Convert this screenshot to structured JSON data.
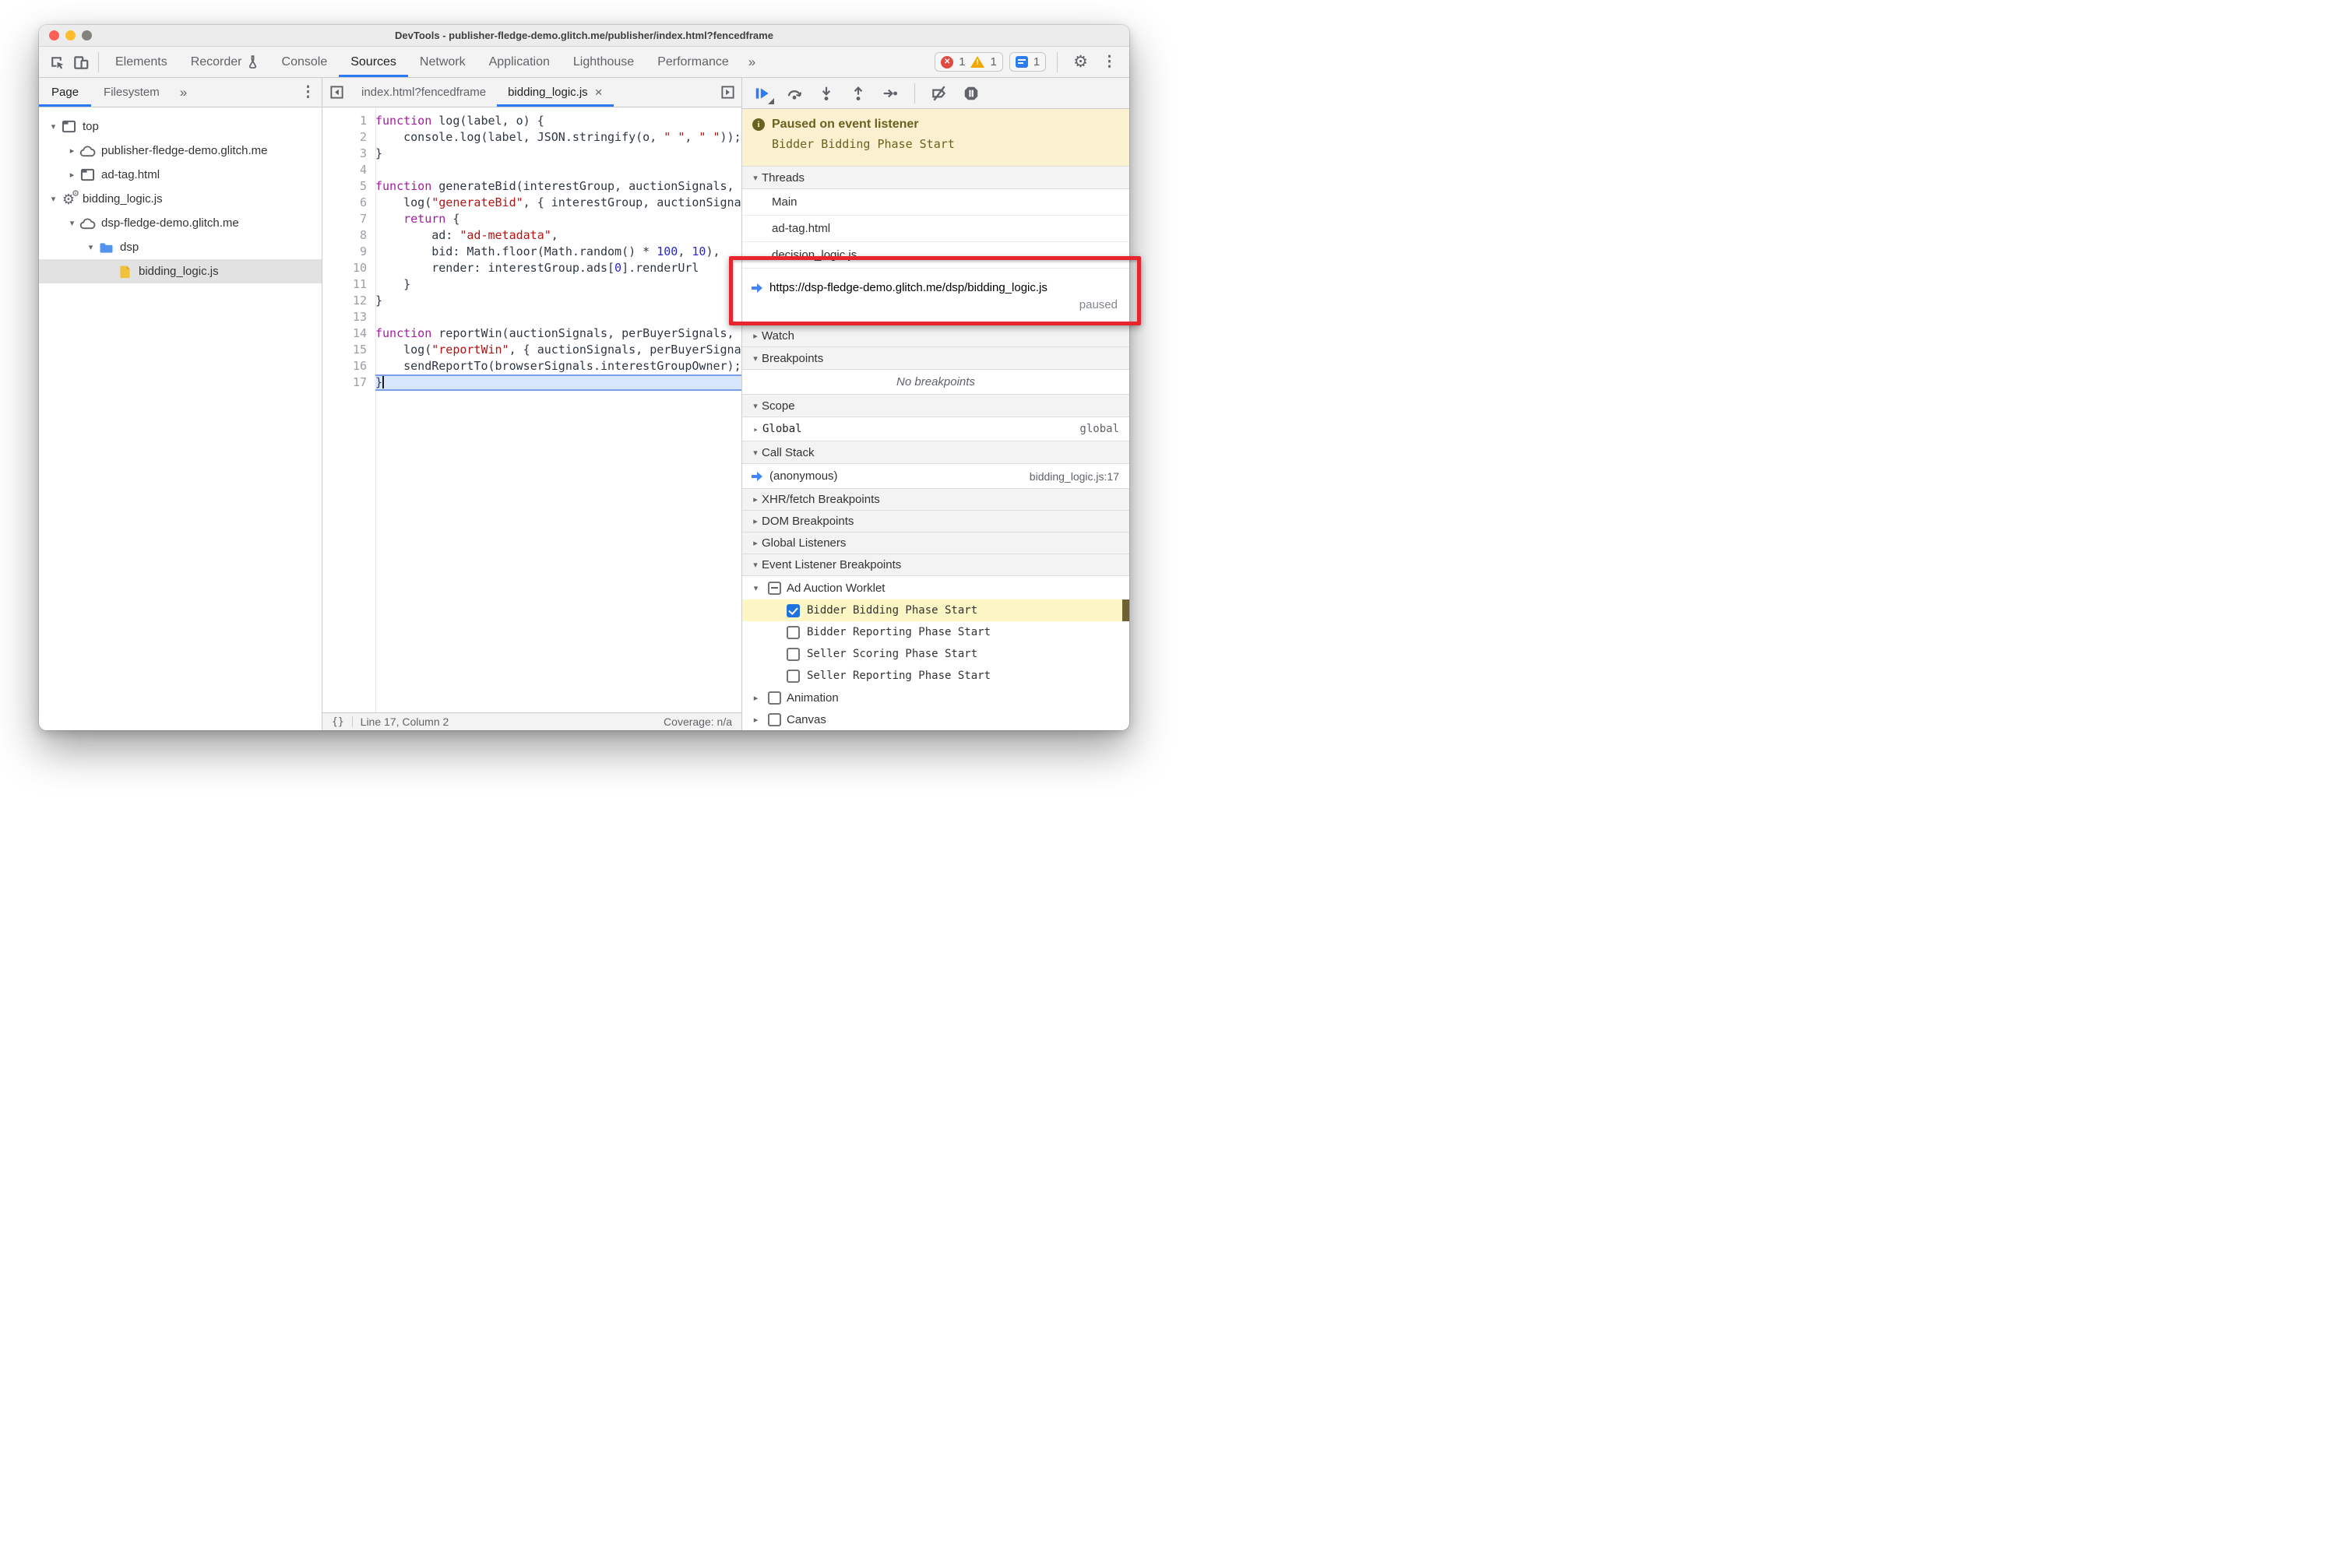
{
  "colors": {
    "accent_blue": "#2d7af7",
    "annotation_red": "#e8252c",
    "paused_banner_bg": "#fbf1d1",
    "paused_banner_text": "#6a6120",
    "highlight_row_yellow": "#fbf6c3",
    "exec_line_blue": "#d9e7fd",
    "traffic_close": "#fe5f57",
    "traffic_minimize": "#febc2e",
    "traffic_zoom_disabled": "#83837b"
  },
  "glyphs": {
    "expanded": "▾",
    "collapsed": "▸",
    "overflow": "»",
    "kebab": "⋮",
    "gear": "⚙",
    "close_tab": "×",
    "brackets": "{}"
  },
  "window": {
    "title": "DevTools - publisher-fledge-demo.glitch.me/publisher/index.html?fencedframe"
  },
  "toolbar": {
    "tabs": [
      {
        "label": "Elements"
      },
      {
        "label": "Recorder",
        "flask": true
      },
      {
        "label": "Console"
      },
      {
        "label": "Sources",
        "selected": true
      },
      {
        "label": "Network"
      },
      {
        "label": "Application"
      },
      {
        "label": "Lighthouse"
      },
      {
        "label": "Performance"
      }
    ],
    "error_count": "1",
    "warning_count": "1",
    "issue_count": "1"
  },
  "navigator": {
    "tabs": [
      {
        "label": "Page",
        "selected": true
      },
      {
        "label": "Filesystem"
      }
    ],
    "tree": [
      {
        "label": "top",
        "depth": 0,
        "icon": "frame",
        "expand": "open"
      },
      {
        "label": "publisher-fledge-demo.glitch.me",
        "depth": 1,
        "icon": "cloud",
        "expand": "closed"
      },
      {
        "label": "ad-tag.html",
        "depth": 1,
        "icon": "frame",
        "expand": "closed"
      },
      {
        "label": "bidding_logic.js",
        "depth": 0,
        "icon": "worker",
        "expand": "open"
      },
      {
        "label": "dsp-fledge-demo.glitch.me",
        "depth": 1,
        "icon": "cloud",
        "expand": "open"
      },
      {
        "label": "dsp",
        "depth": 2,
        "icon": "folder",
        "expand": "open"
      },
      {
        "label": "bidding_logic.js",
        "depth": 3,
        "icon": "file",
        "expand": "none",
        "selected": true
      }
    ]
  },
  "editor": {
    "tabs": [
      {
        "label": "index.html?fencedframe"
      },
      {
        "label": "bidding_logic.js",
        "selected": true,
        "close": "×"
      }
    ],
    "lines": [
      {
        "n": "1",
        "seg": [
          [
            "k",
            "function"
          ],
          [
            "d",
            " log(label, o) {"
          ]
        ]
      },
      {
        "n": "2",
        "seg": [
          [
            "d",
            "    console.log(label, JSON.stringify(o, "
          ],
          [
            "s",
            "\" \""
          ],
          [
            "d",
            ", "
          ],
          [
            "s",
            "\" \""
          ],
          [
            "d",
            "));"
          ]
        ]
      },
      {
        "n": "3",
        "seg": [
          [
            "d",
            "}"
          ]
        ]
      },
      {
        "n": "4",
        "seg": []
      },
      {
        "n": "5",
        "seg": [
          [
            "k",
            "function"
          ],
          [
            "d",
            " generateBid(interestGroup, auctionSignals, perBuyerSignals, trustedBiddingSignals, browserSignals) {"
          ]
        ]
      },
      {
        "n": "6",
        "seg": [
          [
            "d",
            "    log("
          ],
          [
            "s",
            "\"generateBid\""
          ],
          [
            "d",
            ", { interestGroup, auctionSignals, perBuyerSignals, trustedBiddingSignals });"
          ]
        ]
      },
      {
        "n": "7",
        "seg": [
          [
            "d",
            "    "
          ],
          [
            "k",
            "return"
          ],
          [
            "d",
            " {"
          ]
        ]
      },
      {
        "n": "8",
        "seg": [
          [
            "d",
            "        ad: "
          ],
          [
            "s",
            "\"ad-metadata\""
          ],
          [
            "d",
            ","
          ]
        ]
      },
      {
        "n": "9",
        "seg": [
          [
            "d",
            "        bid: Math.floor(Math.random() * "
          ],
          [
            "n2",
            "100"
          ],
          [
            "d",
            ", "
          ],
          [
            "n2",
            "10"
          ],
          [
            "d",
            "),"
          ]
        ]
      },
      {
        "n": "10",
        "seg": [
          [
            "d",
            "        render: interestGroup.ads["
          ],
          [
            "n2",
            "0"
          ],
          [
            "d",
            "].renderUrl"
          ]
        ]
      },
      {
        "n": "11",
        "seg": [
          [
            "d",
            "    }"
          ]
        ]
      },
      {
        "n": "12",
        "seg": [
          [
            "d",
            "}"
          ]
        ]
      },
      {
        "n": "13",
        "seg": []
      },
      {
        "n": "14",
        "seg": [
          [
            "k",
            "function"
          ],
          [
            "d",
            " reportWin(auctionSignals, perBuyerSignals, sellerSignals, browserSignals) {"
          ]
        ]
      },
      {
        "n": "15",
        "seg": [
          [
            "d",
            "    log("
          ],
          [
            "s",
            "\"reportWin\""
          ],
          [
            "d",
            ", { auctionSignals, perBuyerSignals, sellerSignals, browserSignals });"
          ]
        ]
      },
      {
        "n": "16",
        "seg": [
          [
            "d",
            "    sendReportTo(browserSignals.interestGroupOwner);"
          ]
        ]
      },
      {
        "n": "17",
        "seg": [
          [
            "d",
            "}"
          ]
        ],
        "paused": true,
        "cursor": true
      }
    ],
    "status": {
      "brackets": "{}",
      "position": "Line 17, Column 2",
      "coverage": "Coverage: n/a"
    }
  },
  "debugger": {
    "banner": {
      "title": "Paused on event listener",
      "subtitle": "Bidder Bidding Phase Start"
    },
    "threads": {
      "header": "Threads",
      "items": [
        "Main",
        "ad-tag.html",
        "decision_logic.js"
      ],
      "paused_item": {
        "url": "https://dsp-fledge-demo.glitch.me/dsp/bidding_logic.js",
        "state": "paused"
      }
    },
    "watch": {
      "header": "Watch"
    },
    "breakpoints": {
      "header": "Breakpoints",
      "empty": "No breakpoints"
    },
    "scope": {
      "header": "Scope",
      "rows": [
        {
          "name": "Global",
          "value": "global"
        }
      ]
    },
    "call_stack": {
      "header": "Call Stack",
      "frames": [
        {
          "name": "(anonymous)",
          "location": "bidding_logic.js:17"
        }
      ]
    },
    "xhr": {
      "header": "XHR/fetch Breakpoints"
    },
    "dom": {
      "header": "DOM Breakpoints"
    },
    "global_listeners": {
      "header": "Global Listeners"
    },
    "event_listener_breakpoints": {
      "header": "Event Listener Breakpoints",
      "group": {
        "label": "Ad Auction Worklet",
        "state": "indeterminate"
      },
      "children": [
        {
          "label": "Bidder Bidding Phase Start",
          "checked": true,
          "highlight": true
        },
        {
          "label": "Bidder Reporting Phase Start"
        },
        {
          "label": "Seller Scoring Phase Start"
        },
        {
          "label": "Seller Reporting Phase Start"
        }
      ],
      "siblings": [
        {
          "label": "Animation"
        },
        {
          "label": "Canvas"
        }
      ]
    }
  }
}
